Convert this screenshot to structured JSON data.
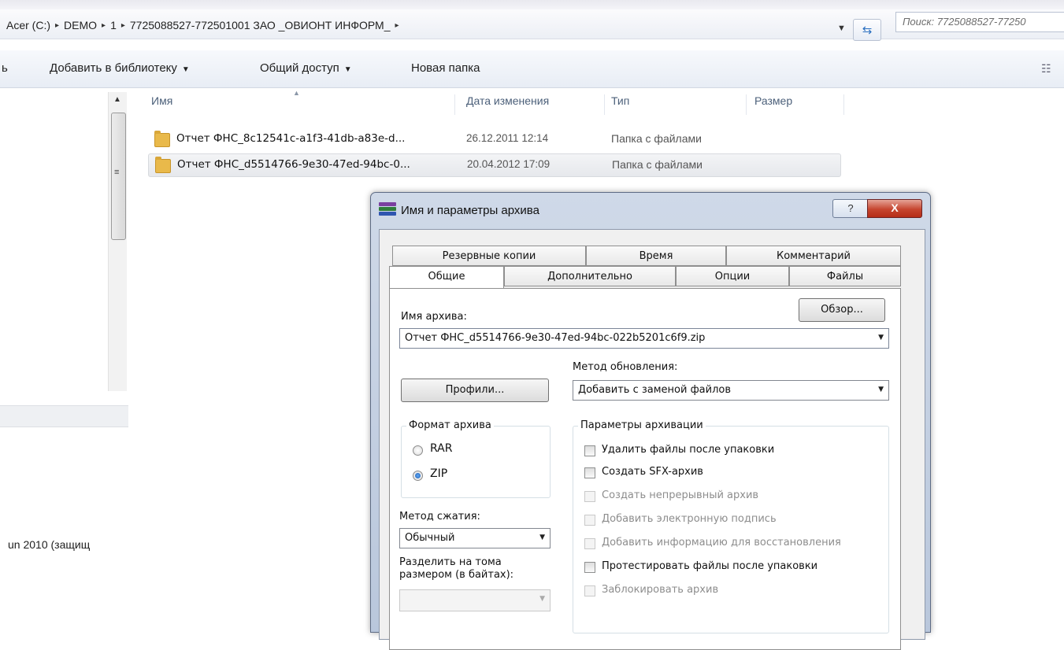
{
  "explorer": {
    "breadcrumb": [
      "Acer (C:)",
      "DEMO",
      "1",
      "7725088527-772501001 ЗАО _ОВИОНТ ИНФОРМ_"
    ],
    "separator": "▸",
    "search_placeholder": "Поиск: 7725088527-77250",
    "toolbar": {
      "cut_left": "ь",
      "add_to_library": "Добавить в библиотеку",
      "share": "Общий доступ",
      "new_folder": "Новая папка"
    },
    "columns": {
      "name": "Имя",
      "date": "Дата изменения",
      "type": "Тип",
      "size": "Размер"
    },
    "files": [
      {
        "name": "Отчет ФНС_8c12541c-a1f3-41db-a83e-d...",
        "date": "26.12.2011 12:14",
        "type": "Папка с файлами",
        "size": ""
      },
      {
        "name": "Отчет ФНС_d5514766-9e30-47ed-94bc-0...",
        "date": "20.04.2012 17:09",
        "type": "Папка с файлами",
        "size": ""
      }
    ],
    "selected_row": 1,
    "nav_truncated_item": "un 2010 (защищ"
  },
  "dialog": {
    "title": "Имя и параметры архива",
    "help_label": "?",
    "close_label": "X",
    "tabs_back": [
      "Резервные копии",
      "Время",
      "Комментарий"
    ],
    "tabs_front": [
      "Общие",
      "Дополнительно",
      "Опции",
      "Файлы"
    ],
    "active_tab": "Общие",
    "archive_name_label": "Имя архива:",
    "browse_button": "Обзор...",
    "archive_name_value": "Отчет ФНС_d5514766-9e30-47ed-94bc-022b5201c6f9.zip",
    "update_method_label": "Метод обновления:",
    "update_method_value": "Добавить с заменой файлов",
    "profiles_button": "Профили...",
    "format_group": {
      "title": "Формат архива",
      "options": [
        "RAR",
        "ZIP"
      ],
      "selected": "ZIP"
    },
    "compression_label": "Метод сжатия:",
    "compression_value": "Обычный",
    "split_label_line1": "Разделить на тома",
    "split_label_line2": "размером (в байтах):",
    "split_value": "",
    "params_group": {
      "title": "Параметры архивации",
      "options": [
        {
          "label": "Удалить файлы после упаковки",
          "checked": false,
          "enabled": true
        },
        {
          "label": "Создать SFX-архив",
          "checked": false,
          "enabled": true
        },
        {
          "label": "Создать непрерывный архив",
          "checked": false,
          "enabled": false
        },
        {
          "label": "Добавить электронную подпись",
          "checked": false,
          "enabled": false
        },
        {
          "label": "Добавить информацию для восстановления",
          "checked": false,
          "enabled": false
        },
        {
          "label": "Протестировать файлы после упаковки",
          "checked": false,
          "enabled": true
        },
        {
          "label": "Заблокировать архив",
          "checked": false,
          "enabled": false
        }
      ]
    }
  },
  "colors": {
    "close_button": "#c6452f",
    "folder": "#e9b94a",
    "selected_radio": "#1c5fb8"
  }
}
